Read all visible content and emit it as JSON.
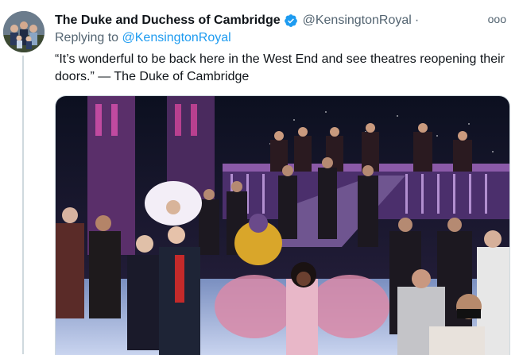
{
  "tweet": {
    "display_name": "The Duke and Duchess of Cambridge",
    "handle": "@KensingtonRoyal",
    "separator": "·",
    "more_glyph": "ooo",
    "reply_prefix": "Replying to",
    "reply_to": "@KensingtonRoyal",
    "text": "“It’s wonderful to be back here in the West End and see theatres reopening their doors.” — The Duke of Cambridge"
  },
  "icons": {
    "verified": "verified-badge-icon",
    "more": "more-options-icon"
  },
  "colors": {
    "link": "#1d9bf0",
    "secondary_text": "#536471",
    "primary_text": "#0f1419",
    "verified": "#1d9bf0",
    "thread_line": "#cfd9de"
  }
}
